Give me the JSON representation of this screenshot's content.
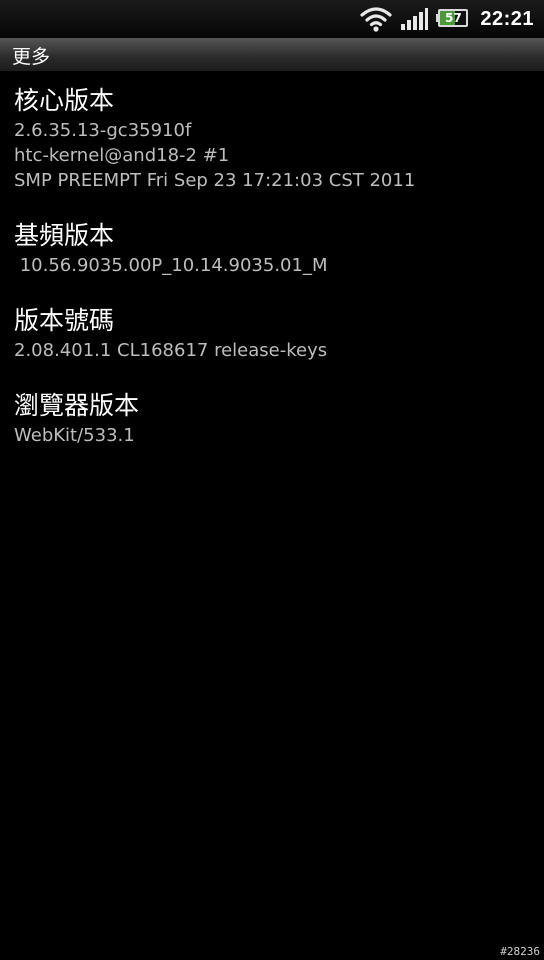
{
  "status_bar": {
    "time": "22:21",
    "battery_level": "57",
    "battery_fraction": 0.57,
    "icons": [
      "wifi-icon",
      "signal-icon",
      "battery-icon"
    ]
  },
  "title_bar": {
    "title": "更多"
  },
  "items": [
    {
      "title": "核心版本",
      "lines": [
        "2.6.35.13-gc35910f",
        "htc-kernel@and18-2 #1",
        "SMP PREEMPT Fri Sep 23 17:21:03 CST 2011"
      ]
    },
    {
      "title": "基頻版本",
      "lines": [
        " 10.56.9035.00P_10.14.9035.01_M"
      ]
    },
    {
      "title": "版本號碼",
      "lines": [
        "2.08.401.1 CL168617 release-keys"
      ]
    },
    {
      "title": "瀏覽器版本",
      "lines": [
        "WebKit/533.1"
      ]
    }
  ],
  "watermark": "#28236"
}
